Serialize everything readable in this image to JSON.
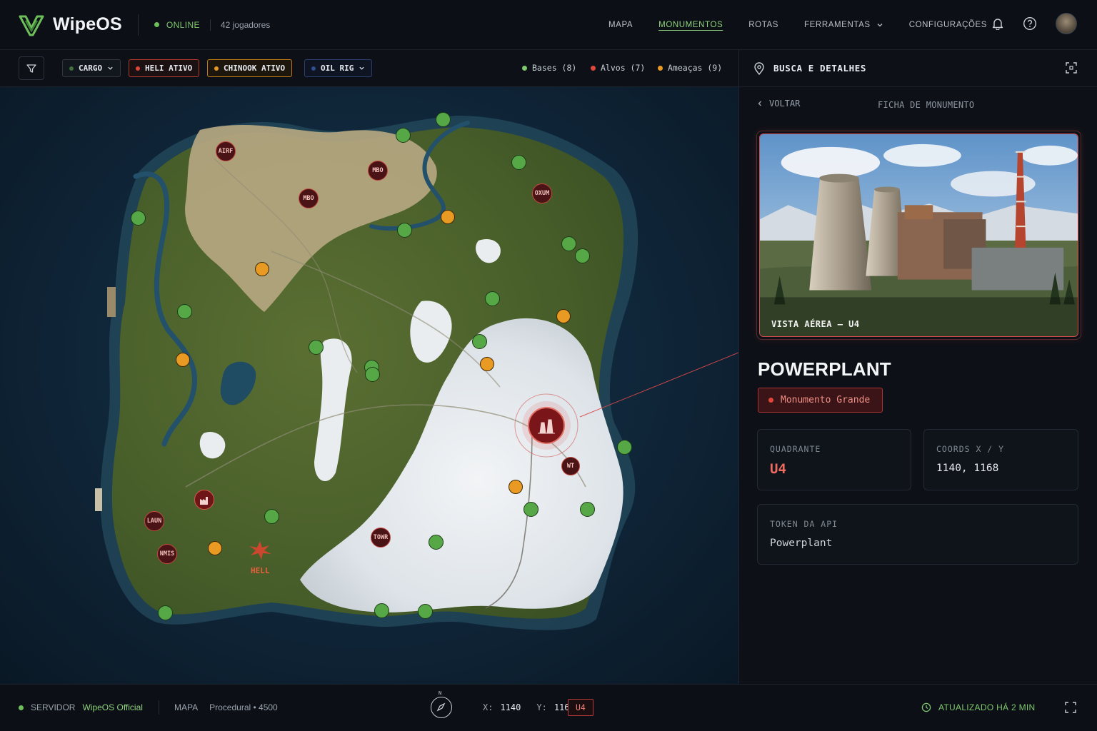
{
  "app": {
    "name_prefix": "Wipe",
    "name_suffix": "OS",
    "status": "ONLINE",
    "players": "42 jogadores"
  },
  "nav": {
    "items": [
      "MAPA",
      "MONUMENTOS",
      "ROTAS",
      "FERRAMENTAS",
      "CONFIGURAÇÕES"
    ],
    "active": "MONUMENTOS"
  },
  "filters": {
    "chips": [
      {
        "label": "CARGO",
        "color": "#3f6f3a",
        "border": "#2f3641",
        "dropdown": true
      },
      {
        "label": "HELI ATIVO",
        "color": "#e0463a",
        "border": "#b03a2e",
        "dropdown": false
      },
      {
        "label": "CHINOOK ATIVO",
        "color": "#e89a23",
        "border": "#c07b18",
        "dropdown": false
      },
      {
        "label": "OIL RIG",
        "color": "#2f4c8c",
        "border": "#2a3f70",
        "dropdown": true
      }
    ],
    "legend": [
      {
        "label": "Bases (8)",
        "color": "#7ec86d"
      },
      {
        "label": "Alvos (7)",
        "color": "#e0463a"
      },
      {
        "label": "Ameaças (9)",
        "color": "#e89a23"
      }
    ]
  },
  "map": {
    "monuments": [
      {
        "label": "AIRF"
      },
      {
        "label": "MBO"
      },
      {
        "label": "MBO"
      },
      {
        "label": "OXUM"
      },
      {
        "label": "LAUN"
      },
      {
        "label": "NMIS"
      },
      {
        "label": "TOWR"
      },
      {
        "label": "WT"
      }
    ],
    "hell_label": "HELL"
  },
  "panel": {
    "title": "BUSCA E DETALHES",
    "back": "VOLTAR",
    "section": "FICHA DE MONUMENTO",
    "photo_caption": "VISTA AÉREA – U4",
    "monument_name": "POWERPLANT",
    "tag": "Monumento Grande",
    "quadrant_label": "QUADRANTE",
    "quadrant_value": "U4",
    "coords_label": "COORDS X / Y",
    "coords_value": "1140, 1168",
    "token_label": "TOKEN DA API",
    "token_value": "Powerplant"
  },
  "footer": {
    "server_label": "SERVIDOR",
    "server_name": "WipeOS Official",
    "map_label": "MAPA",
    "map_value": "Procedural • 4500",
    "compass_n": "N",
    "x_label": "X:",
    "x_value": "1140",
    "y_label": "Y:",
    "y_value": "1168",
    "quadrant": "U4",
    "updated": "ATUALIZADO HÁ 2 MIN"
  },
  "colors": {
    "accent_green": "#7ec86d",
    "accent_red": "#e0463a",
    "accent_orange": "#e89a23"
  }
}
